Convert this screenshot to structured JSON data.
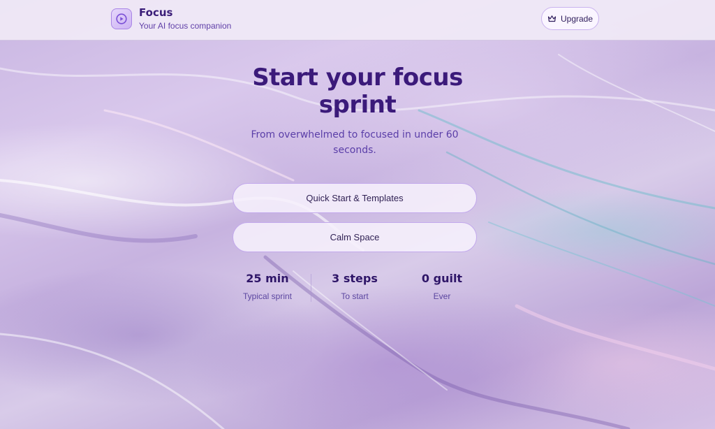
{
  "header": {
    "brand_title": "Focus",
    "brand_subtitle": "Your AI focus companion",
    "upgrade_label": "Upgrade",
    "logo_icon": "play-circle-icon",
    "upgrade_icon": "crown-icon"
  },
  "hero": {
    "title": "Start your focus sprint",
    "subtitle": "From overwhelmed to focused in under 60 seconds."
  },
  "actions": {
    "quick_start_label": "Quick Start & Templates",
    "calm_space_label": "Calm Space"
  },
  "stats": [
    {
      "value": "25 min",
      "label": "Typical sprint"
    },
    {
      "value": "3 steps",
      "label": "To start"
    },
    {
      "value": "0 guilt",
      "label": "Ever"
    }
  ],
  "colors": {
    "accent": "#3b1a7a",
    "secondary_text": "#5a3ea8",
    "button_border": "#c2a8ec"
  }
}
